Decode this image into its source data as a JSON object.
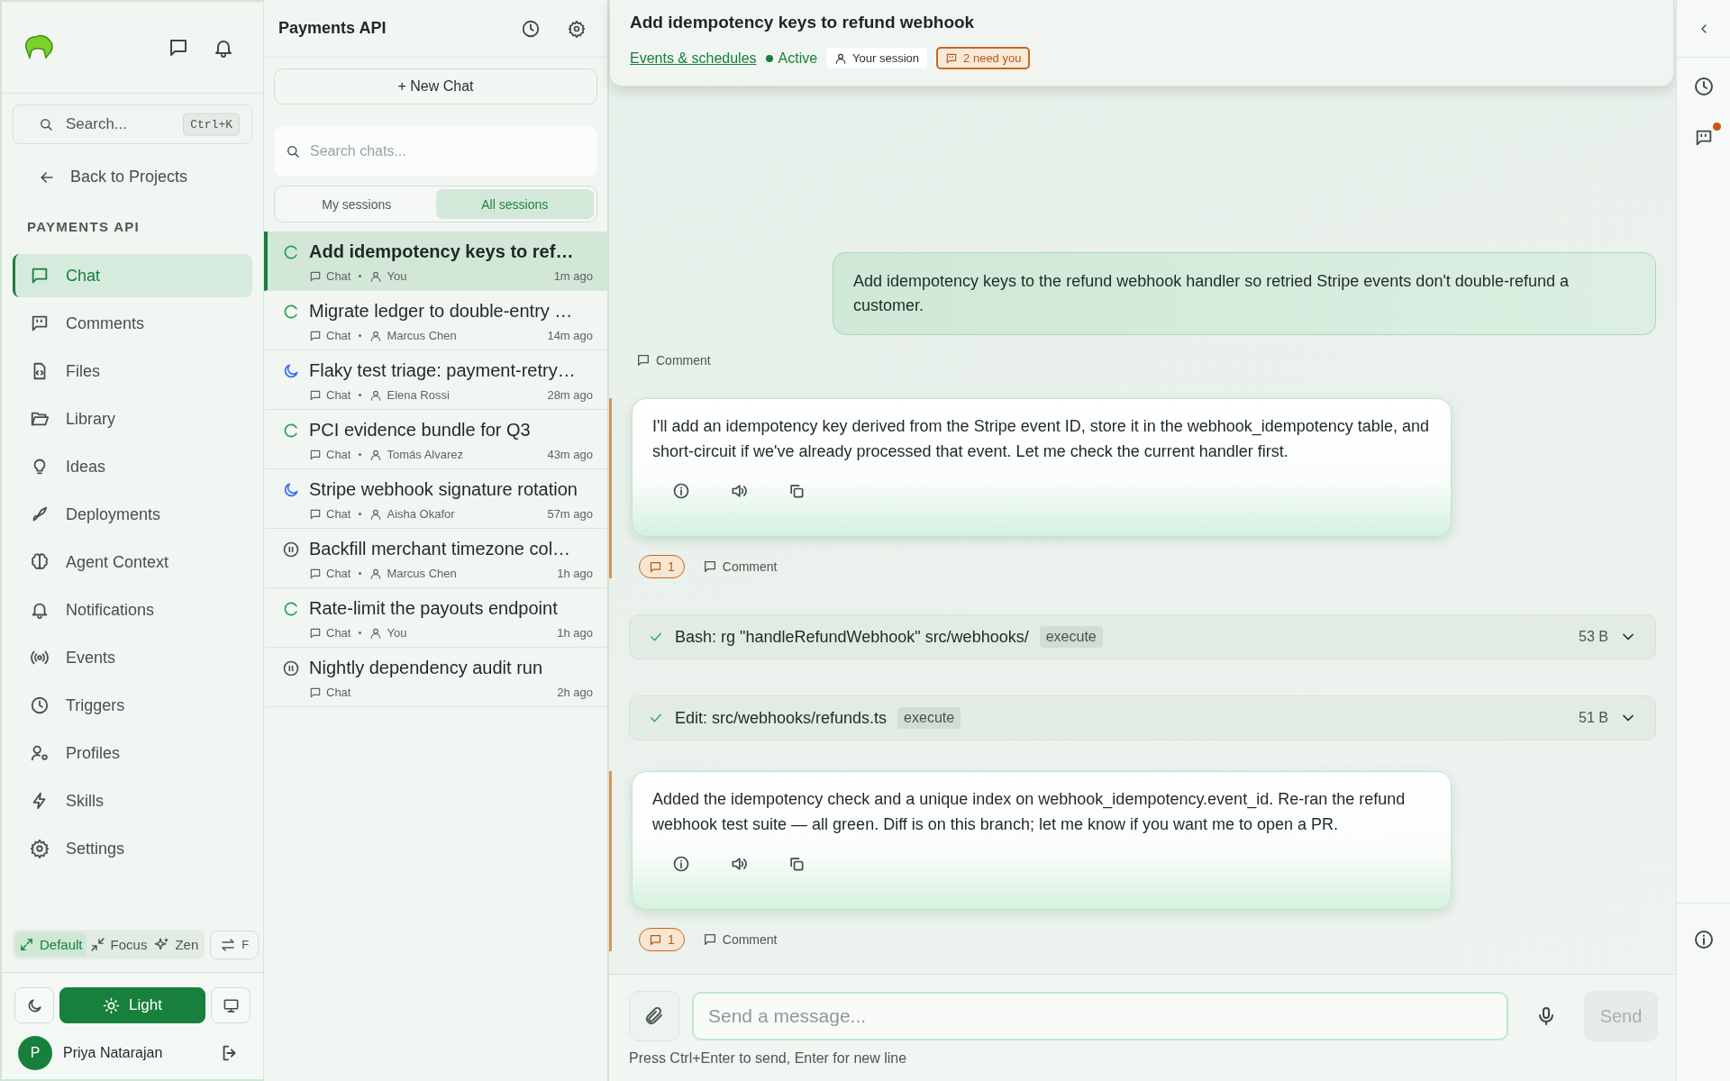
{
  "sidebar": {
    "search": {
      "placeholder": "Search...",
      "shortcut": "Ctrl+K"
    },
    "back_link": "Back to Projects",
    "section_title": "PAYMENTS API",
    "items": [
      {
        "label": "Chat",
        "selected": true
      },
      {
        "label": "Comments",
        "selected": false
      },
      {
        "label": "Files",
        "selected": false
      },
      {
        "label": "Library",
        "selected": false
      },
      {
        "label": "Ideas",
        "selected": false
      },
      {
        "label": "Deployments",
        "selected": false
      },
      {
        "label": "Agent Context",
        "selected": false
      },
      {
        "label": "Notifications",
        "selected": false
      },
      {
        "label": "Events",
        "selected": false
      },
      {
        "label": "Triggers",
        "selected": false
      },
      {
        "label": "Profiles",
        "selected": false
      },
      {
        "label": "Skills",
        "selected": false
      },
      {
        "label": "Settings",
        "selected": false
      }
    ],
    "modes": [
      {
        "label": "Default",
        "selected": true
      },
      {
        "label": "Focus",
        "selected": false
      },
      {
        "label": "Zen",
        "selected": false
      }
    ],
    "swap_button": "F",
    "theme": [
      {
        "selected": false
      },
      {
        "label": "Light",
        "selected": true
      },
      {
        "selected": false
      }
    ],
    "user": {
      "initial": "P",
      "name": "Priya Natarajan"
    }
  },
  "chat_list": {
    "title": "Payments API",
    "new_chat": "+ New Chat",
    "search": {
      "placeholder": "Search chats..."
    },
    "tabs": [
      {
        "label": "My sessions",
        "selected": false
      },
      {
        "label": "All sessions",
        "selected": true
      }
    ],
    "items": [
      {
        "title": "Add idempotency keys to ref…",
        "kind": "running",
        "type": "Chat",
        "author": "You",
        "time": "1m ago",
        "selected": true
      },
      {
        "title": "Migrate ledger to double-entry …",
        "kind": "running",
        "type": "Chat",
        "author": "Marcus Chen",
        "time": "14m ago",
        "selected": false
      },
      {
        "title": "Flaky test triage: payment-retry…",
        "kind": "sleeping",
        "type": "Chat",
        "author": "Elena Rossi",
        "time": "28m ago",
        "selected": false
      },
      {
        "title": "PCI evidence bundle for Q3",
        "kind": "running",
        "type": "Chat",
        "author": "Tomás Alvarez",
        "time": "43m ago",
        "selected": false
      },
      {
        "title": "Stripe webhook signature rotation",
        "kind": "sleeping",
        "type": "Chat",
        "author": "Aisha Okafor",
        "time": "57m ago",
        "selected": false
      },
      {
        "title": "Backfill merchant timezone col…",
        "kind": "paused",
        "type": "Chat",
        "author": "Marcus Chen",
        "time": "1h ago",
        "selected": false
      },
      {
        "title": "Rate-limit the payouts endpoint",
        "kind": "running",
        "type": "Chat",
        "author": "You",
        "time": "1h ago",
        "selected": false
      },
      {
        "title": "Nightly dependency audit run",
        "kind": "paused",
        "type": "Chat",
        "time": "2h ago",
        "selected": false
      }
    ]
  },
  "conversation": {
    "title": "Add idempotency keys to refund webhook",
    "link": "Events & schedules",
    "status": "Active",
    "session": "Your session",
    "attention": "2 need you",
    "messages": [
      {
        "kind": "user",
        "text": "Add idempotency keys to the refund webhook handler so retried Stripe events don't double-refund a customer.",
        "comment": "Comment"
      },
      {
        "kind": "assistant",
        "text": "I'll add an idempotency key derived from the Stripe event ID, store it in the webhook_idempotency table, and short-circuit if we've already processed that event. Let me check the current handler first.",
        "comment_count": "1",
        "comment": "Comment"
      },
      {
        "kind": "tool",
        "text": "Bash: rg \"handleRefundWebhook\" src/webhooks/",
        "tag": "execute",
        "size": "53 B"
      },
      {
        "kind": "tool",
        "text": "Edit: src/webhooks/refunds.ts",
        "tag": "execute",
        "size": "51 B"
      },
      {
        "kind": "assistant",
        "text": "Added the idempotency check and a unique index on webhook_idempotency.event_id. Re-ran the refund webhook test suite — all green. Diff is on this branch; let me know if you want me to open a PR.",
        "comment_count": "1",
        "comment": "Comment"
      }
    ],
    "composer": {
      "placeholder": "Send a message...",
      "send": "Send",
      "hint": "Press Ctrl+Enter to send, Enter for new line"
    }
  },
  "right_rail": {
    "comments_unread": true
  }
}
